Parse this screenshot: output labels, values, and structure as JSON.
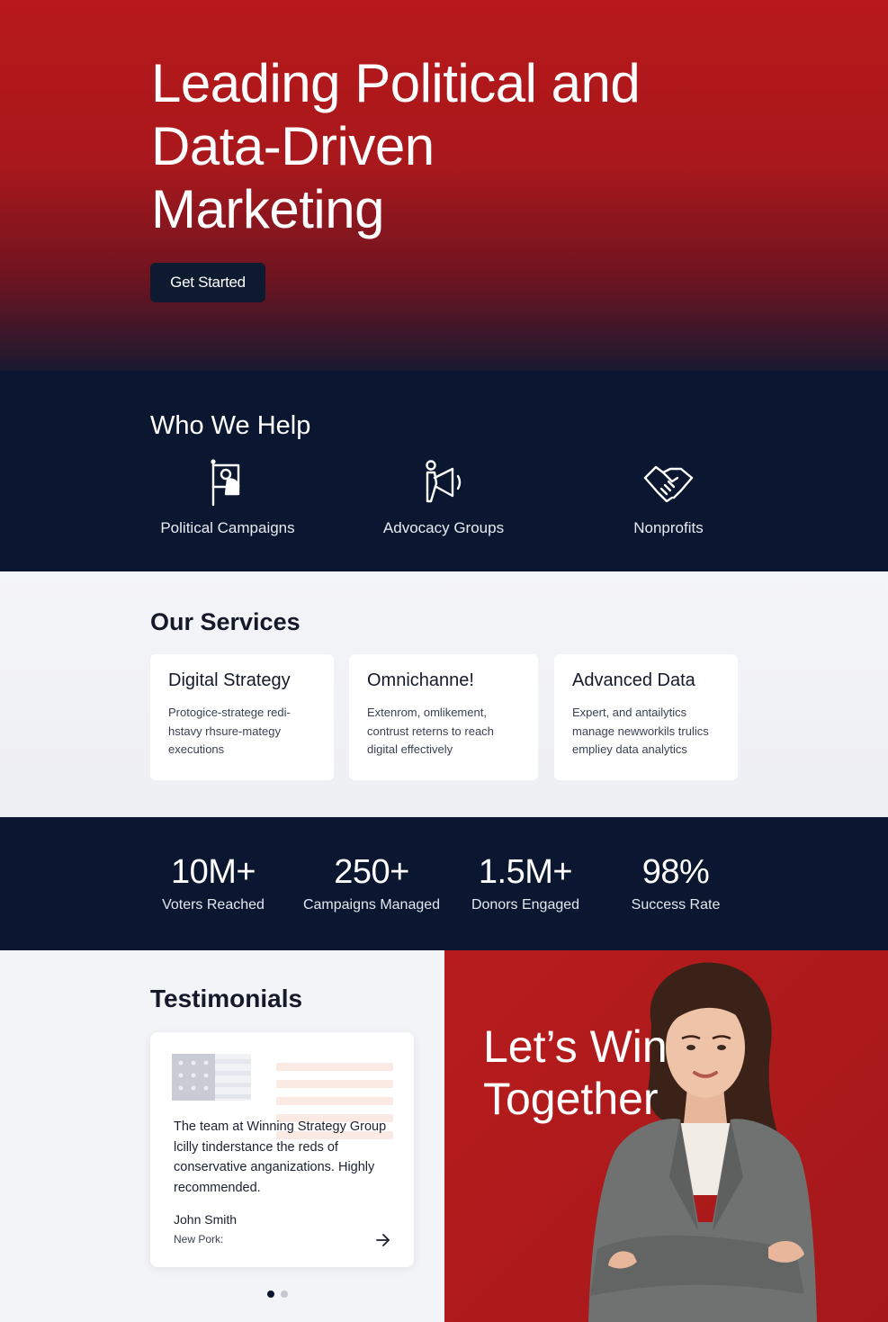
{
  "hero": {
    "title": "Leading Political and Data-Driven Marketing",
    "cta_label": "Get Started"
  },
  "who_we_help": {
    "title": "Who We Help",
    "items": [
      {
        "label": "Political Campaigns",
        "icon": "campaign-flag-icon"
      },
      {
        "label": "Advocacy Groups",
        "icon": "megaphone-icon"
      },
      {
        "label": "Nonprofits",
        "icon": "handshake-icon"
      }
    ]
  },
  "services": {
    "title": "Our Services",
    "cards": [
      {
        "title": "Digital Strategy",
        "description": "Protogice-stratege redi-hstavy rhsure-mategy executions"
      },
      {
        "title": "Omnichanne!",
        "description": "Extenrom, omlikement, contrust reterns to reach digital effectively"
      },
      {
        "title": "Advanced Data",
        "description": "Expert, and antailytics manage newworkils trulics empliey data analytics"
      }
    ]
  },
  "stats": [
    {
      "value": "10M+",
      "label": "Voters Reached"
    },
    {
      "value": "250+",
      "label": "Campaigns Managed"
    },
    {
      "value": "1.5M+",
      "label": "Donors Engaged"
    },
    {
      "value": "98%",
      "label": "Success Rate"
    }
  ],
  "testimonials": {
    "title": "Testimonials",
    "quote": "The team at Winning Strategy Group lcilly tinderstance the reds of conservative anganizations. Highly recommended.",
    "author": "John Smith",
    "location": "New Pork:",
    "active_slide": 1,
    "slide_count": 2
  },
  "cta": {
    "title": "Let’s Win Together"
  },
  "colors": {
    "brand_red": "#b8191a",
    "navy": "#0b1730",
    "light_bg": "#f3f4f7"
  }
}
